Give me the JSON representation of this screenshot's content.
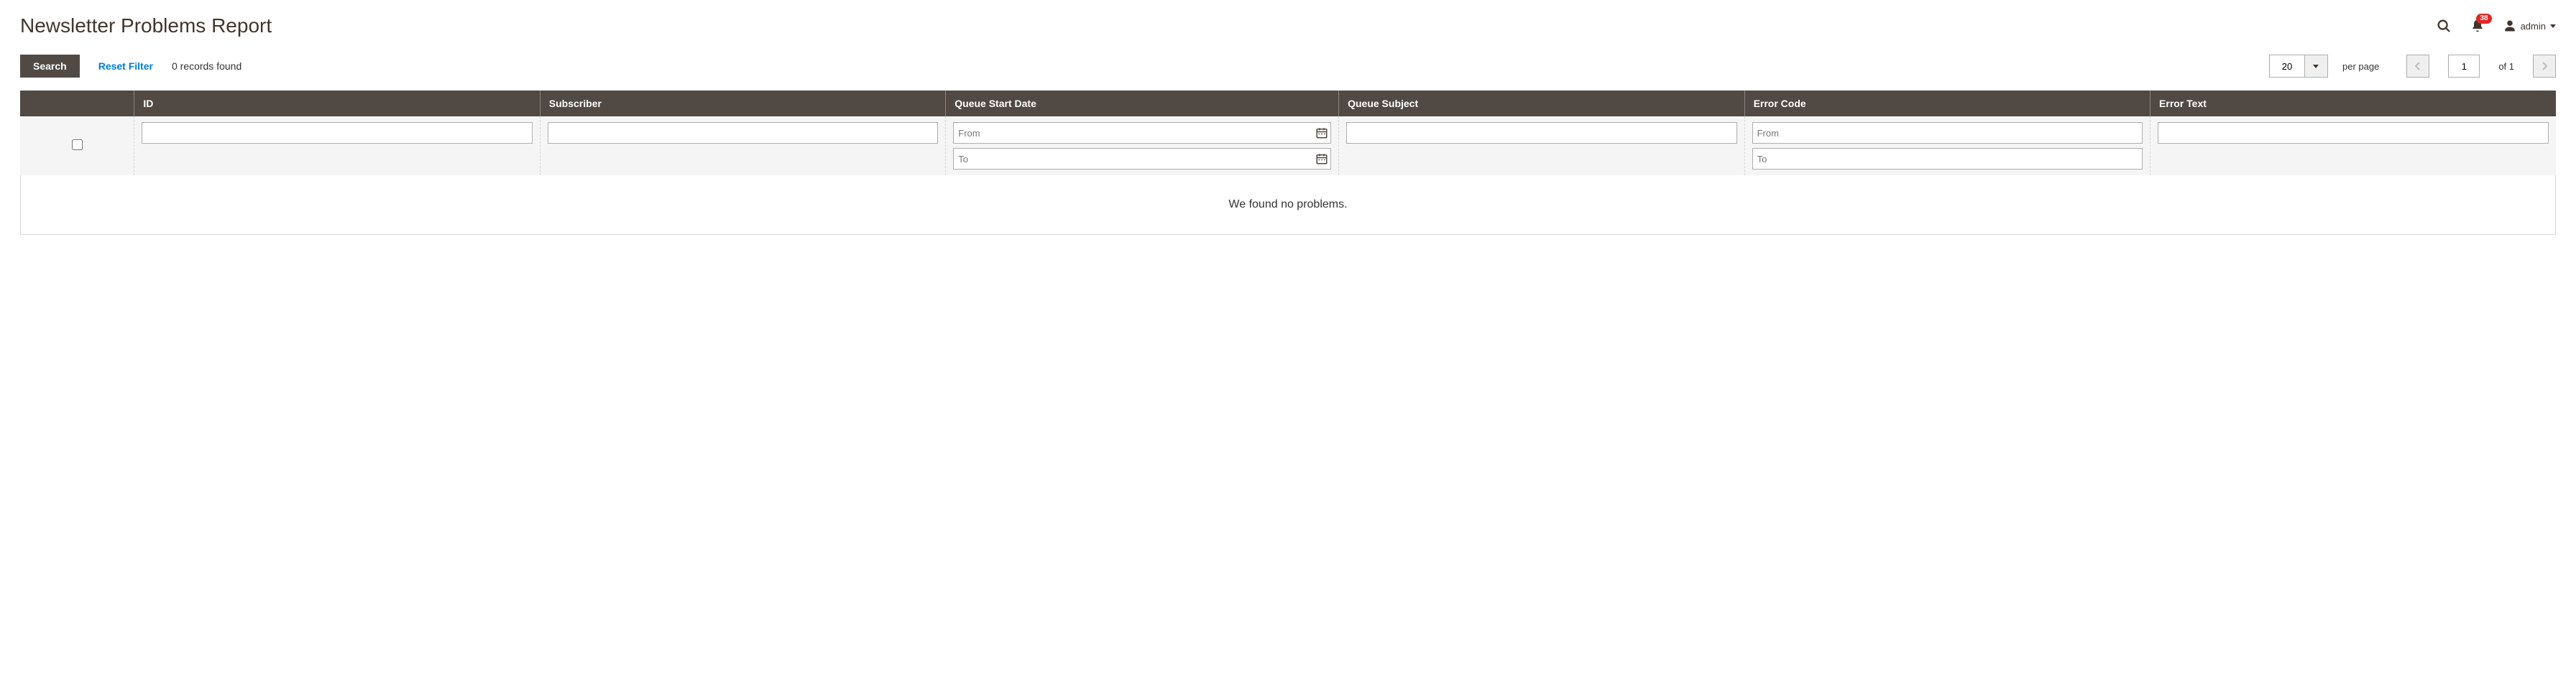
{
  "header": {
    "title": "Newsletter Problems Report",
    "notification_count": "38",
    "username": "admin"
  },
  "toolbar": {
    "search_label": "Search",
    "reset_label": "Reset Filter",
    "records_found": "0 records found",
    "page_size": "20",
    "per_page_label": "per page",
    "current_page": "1",
    "total_pages": "of 1"
  },
  "columns": {
    "id": "ID",
    "subscriber": "Subscriber",
    "queue_start": "Queue Start Date",
    "queue_subject": "Queue Subject",
    "error_code": "Error Code",
    "error_text": "Error Text"
  },
  "filters": {
    "from_placeholder": "From",
    "to_placeholder": "To"
  },
  "empty_message": "We found no problems."
}
